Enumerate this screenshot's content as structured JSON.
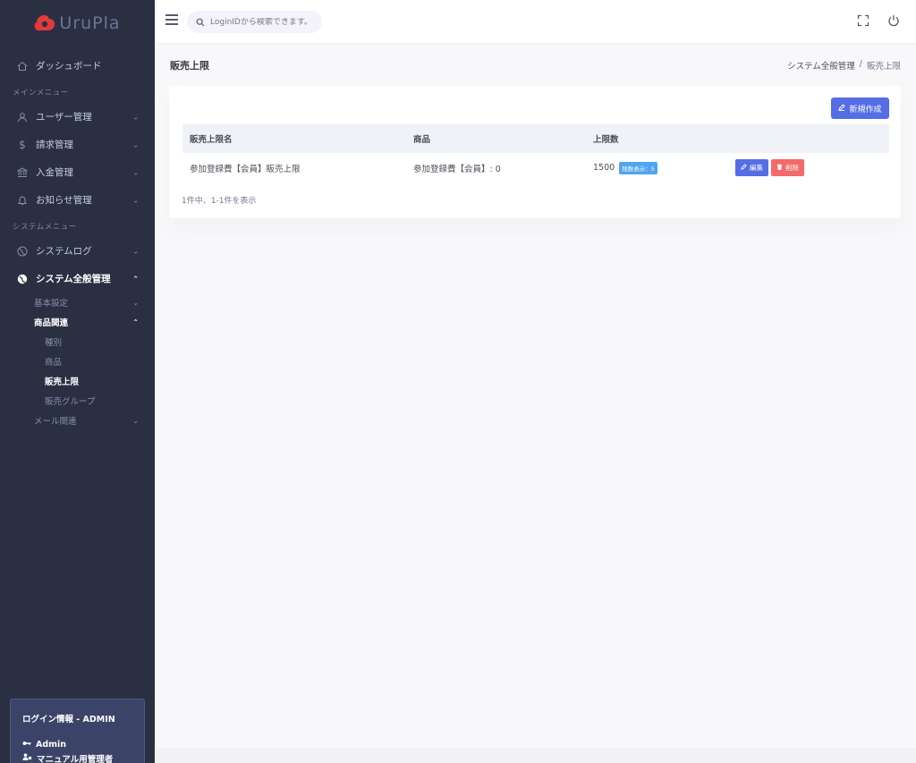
{
  "brand": {
    "name": "UruPla",
    "logo_color": "#e23a3a"
  },
  "sidebar": {
    "dashboard": "ダッシュボード",
    "main_menu_title": "メインメニュー",
    "user_mgmt": "ユーザー管理",
    "billing_mgmt": "請求管理",
    "deposit_mgmt": "入金管理",
    "notice_mgmt": "お知らせ管理",
    "system_menu_title": "システムメニュー",
    "system_log": "システムログ",
    "system_general": "システム全般管理",
    "basic_settings": "基本設定",
    "product_related": "商品関連",
    "category": "種別",
    "product": "商品",
    "sales_limit": "販売上限",
    "sales_group": "販売グループ",
    "mail_related": "メール関連"
  },
  "login_info": {
    "title": "ログイン情報 - ADMIN",
    "user": "Admin",
    "role": "マニュアル用管理者"
  },
  "topbar": {
    "search_placeholder": "LoginIDから検索できます。"
  },
  "page": {
    "title": "販売上限",
    "breadcrumb_parent": "システム全般管理",
    "breadcrumb_sep": "/",
    "breadcrumb_current": "販売上限"
  },
  "table": {
    "new_button": "新規作成",
    "headers": [
      "販売上限名",
      "商品",
      "上限数"
    ],
    "rows": [
      {
        "name": "参加登録費【会員】販売上限",
        "product": "参加登録費【会員】: 0",
        "limit": "1500",
        "badge": "残数表示：5",
        "edit": "編集",
        "delete": "削除"
      }
    ],
    "summary": "1件中、1-1件を表示"
  },
  "colors": {
    "sidebar_bg": "#2a3042",
    "primary": "#556ee6",
    "danger": "#f46a6a",
    "info": "#50a5f1"
  }
}
